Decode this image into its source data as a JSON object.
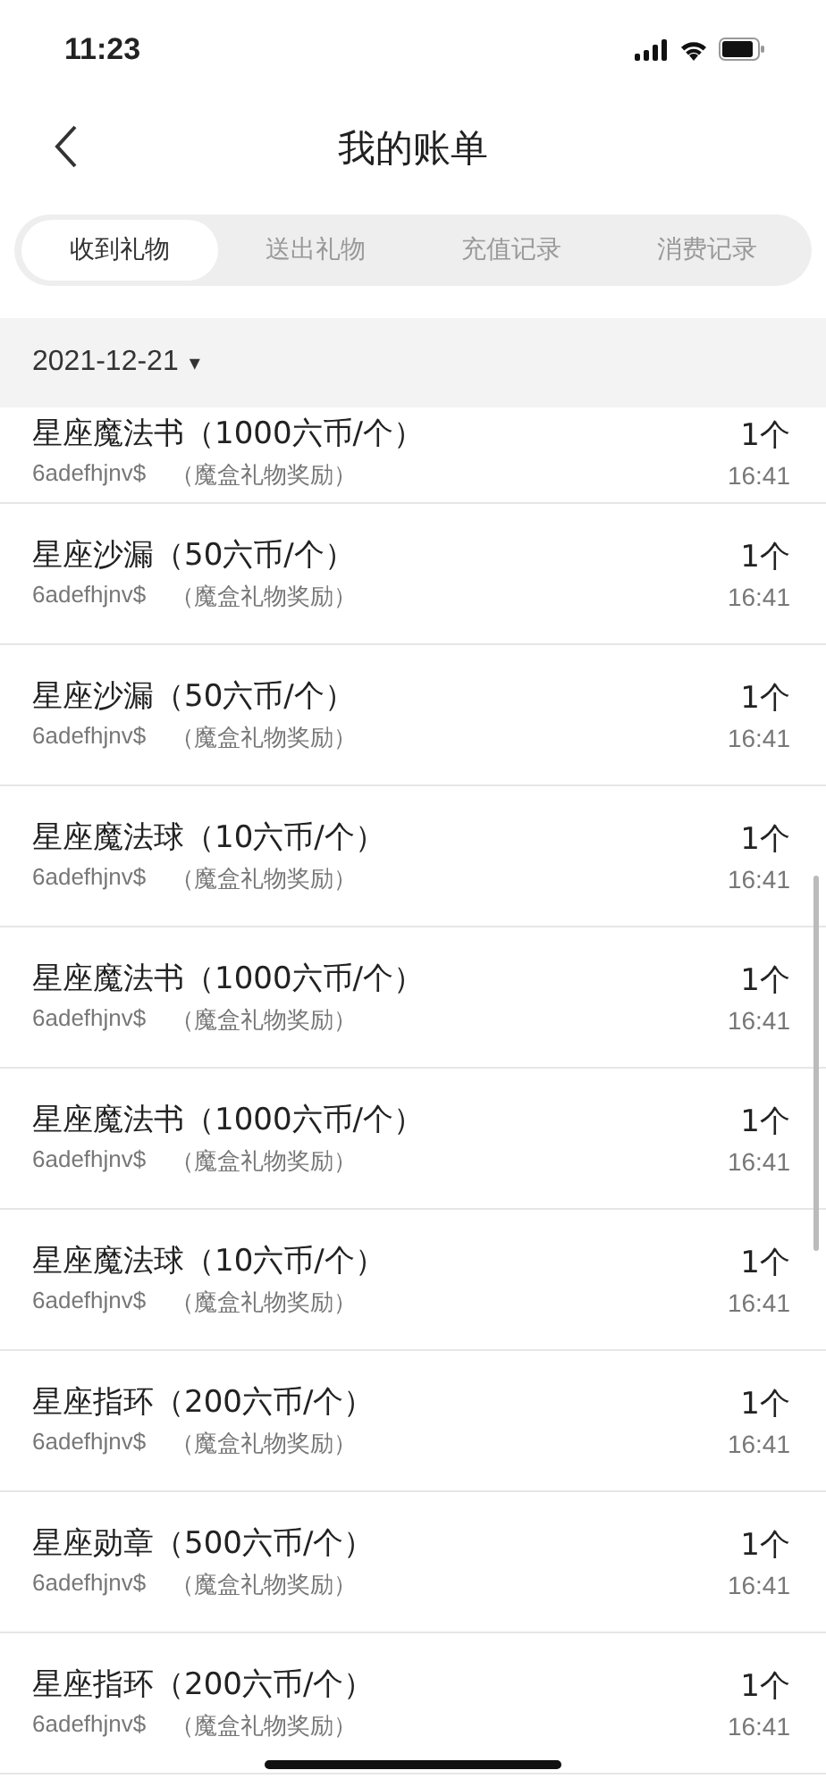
{
  "status_bar": {
    "time": "11:23"
  },
  "nav": {
    "title": "我的账单"
  },
  "tabs": [
    {
      "label": "收到礼物",
      "selected": true
    },
    {
      "label": "送出礼物",
      "selected": false
    },
    {
      "label": "充值记录",
      "selected": false
    },
    {
      "label": "消费记录",
      "selected": false
    }
  ],
  "date_header": {
    "date": "2021-12-21",
    "caret": "▾"
  },
  "records": [
    {
      "name": "星座魔法书（1000六币/个）",
      "user": "6adefhjnv$",
      "source": "（魔盒礼物奖励）",
      "quantity": "1个",
      "time": "16:41"
    },
    {
      "name": "星座沙漏（50六币/个）",
      "user": "6adefhjnv$",
      "source": "（魔盒礼物奖励）",
      "quantity": "1个",
      "time": "16:41"
    },
    {
      "name": "星座沙漏（50六币/个）",
      "user": "6adefhjnv$",
      "source": "（魔盒礼物奖励）",
      "quantity": "1个",
      "time": "16:41"
    },
    {
      "name": "星座魔法球（10六币/个）",
      "user": "6adefhjnv$",
      "source": "（魔盒礼物奖励）",
      "quantity": "1个",
      "time": "16:41"
    },
    {
      "name": "星座魔法书（1000六币/个）",
      "user": "6adefhjnv$",
      "source": "（魔盒礼物奖励）",
      "quantity": "1个",
      "time": "16:41"
    },
    {
      "name": "星座魔法书（1000六币/个）",
      "user": "6adefhjnv$",
      "source": "（魔盒礼物奖励）",
      "quantity": "1个",
      "time": "16:41"
    },
    {
      "name": "星座魔法球（10六币/个）",
      "user": "6adefhjnv$",
      "source": "（魔盒礼物奖励）",
      "quantity": "1个",
      "time": "16:41"
    },
    {
      "name": "星座指环（200六币/个）",
      "user": "6adefhjnv$",
      "source": "（魔盒礼物奖励）",
      "quantity": "1个",
      "time": "16:41"
    },
    {
      "name": "星座勋章（500六币/个）",
      "user": "6adefhjnv$",
      "source": "（魔盒礼物奖励）",
      "quantity": "1个",
      "time": "16:41"
    },
    {
      "name": "星座指环（200六币/个）",
      "user": "6adefhjnv$",
      "source": "（魔盒礼物奖励）",
      "quantity": "1个",
      "time": "16:41"
    }
  ]
}
